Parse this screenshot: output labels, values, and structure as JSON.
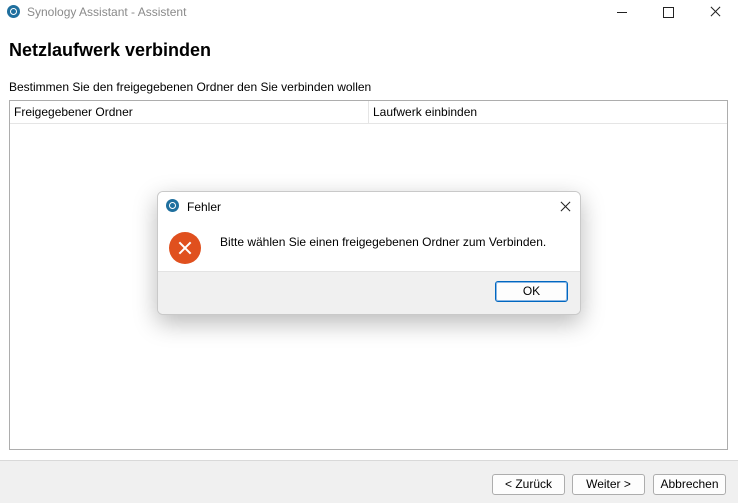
{
  "window": {
    "title": "Synology Assistant - Assistent",
    "app_icon": "synology-assistant-icon"
  },
  "main": {
    "heading": "Netzlaufwerk verbinden",
    "instruction": "Bestimmen Sie den freigegebenen Ordner den Sie verbinden wollen",
    "list": {
      "columns": [
        "Freigegebener Ordner",
        "Laufwerk einbinden"
      ],
      "rows": []
    }
  },
  "footer": {
    "back_label": "< Zurück",
    "next_label": "Weiter >",
    "cancel_label": "Abbrechen"
  },
  "dialog": {
    "title": "Fehler",
    "icon": "error-icon",
    "message": "Bitte wählen Sie einen freigegebenen Ordner zum Verbinden.",
    "ok_label": "OK"
  },
  "colors": {
    "error": "#e0501e",
    "accent": "#0067c0",
    "app_icon": "#1f6f9e"
  }
}
